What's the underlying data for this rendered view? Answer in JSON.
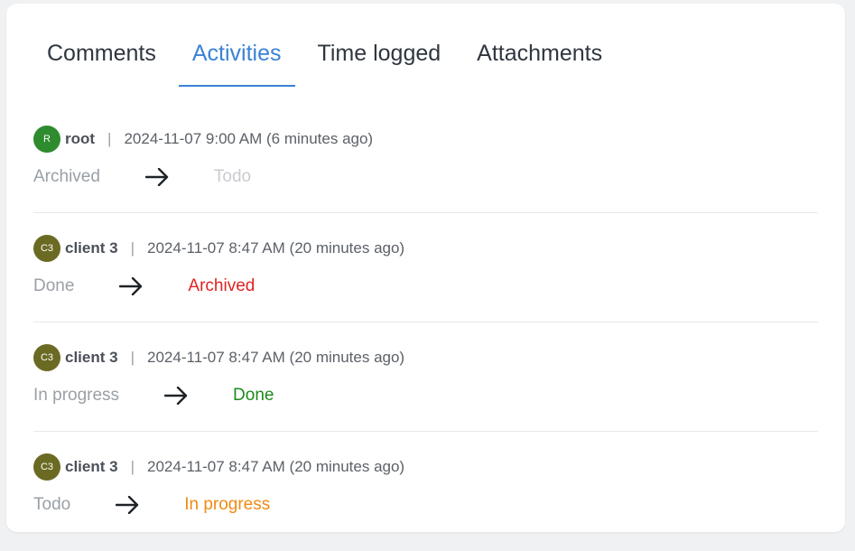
{
  "tabs": [
    {
      "label": "Comments",
      "active": false
    },
    {
      "label": "Activities",
      "active": true
    },
    {
      "label": "Time logged",
      "active": false
    },
    {
      "label": "Attachments",
      "active": false
    }
  ],
  "separator": "|",
  "activities": [
    {
      "avatar_text": "R",
      "avatar_color": "#2e8b2e",
      "user": "root",
      "timestamp": "2024-11-07 9:00 AM (6 minutes ago)",
      "from_status": "Archived",
      "to_status": "Todo",
      "to_color": "#c9cbcf"
    },
    {
      "avatar_text": "C3",
      "avatar_color": "#6b6a23",
      "user": "client 3",
      "timestamp": "2024-11-07 8:47 AM (20 minutes ago)",
      "from_status": "Done",
      "to_status": "Archived",
      "to_color": "#e02424"
    },
    {
      "avatar_text": "C3",
      "avatar_color": "#6b6a23",
      "user": "client 3",
      "timestamp": "2024-11-07 8:47 AM (20 minutes ago)",
      "from_status": "In progress",
      "to_status": "Done",
      "to_color": "#1e8a1e"
    },
    {
      "avatar_text": "C3",
      "avatar_color": "#6b6a23",
      "user": "client 3",
      "timestamp": "2024-11-07 8:47 AM (20 minutes ago)",
      "from_status": "Todo",
      "to_status": "In progress",
      "to_color": "#ef8a12"
    }
  ],
  "icons": {
    "arrow": "arrow-right-icon"
  }
}
